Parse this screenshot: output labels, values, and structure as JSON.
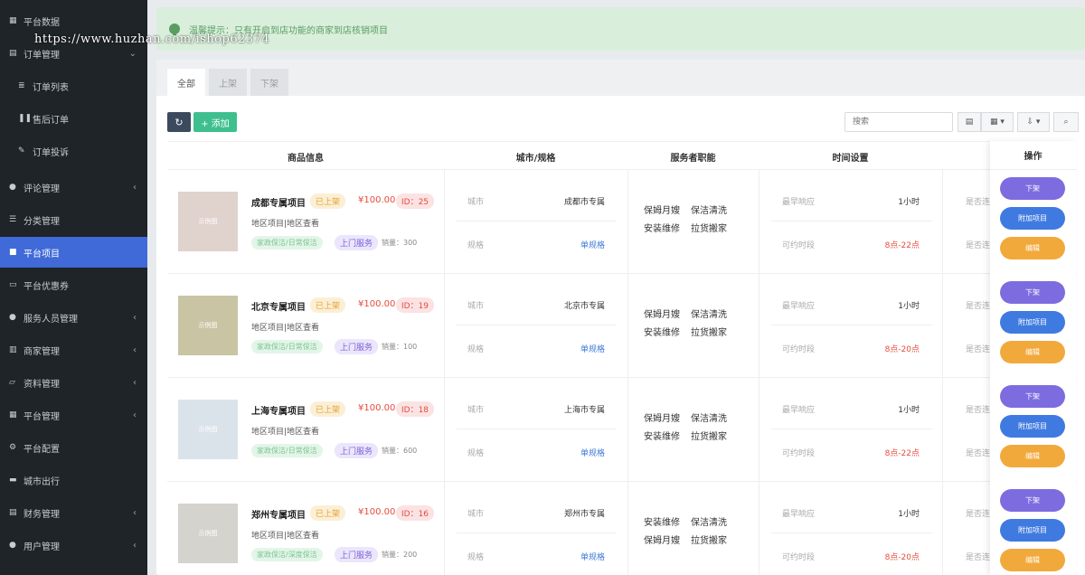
{
  "watermark": "https://www.huzhan.com/ishop62374",
  "sidebar": {
    "items": [
      {
        "label": "平台数据",
        "icon": "bar-chart-icon",
        "glyph": "▦",
        "sub": false,
        "arrow": false,
        "active": false
      },
      {
        "label": "订单管理",
        "icon": "list-icon",
        "glyph": "▤",
        "sub": false,
        "arrow": true,
        "arrow_glyph": "⌄",
        "active": false
      },
      {
        "label": "订单列表",
        "icon": "list-icon",
        "glyph": "≣",
        "sub": true,
        "arrow": false,
        "active": false
      },
      {
        "label": "售后订单",
        "icon": "pause-icon",
        "glyph": "❚❚",
        "sub": true,
        "arrow": false,
        "active": false
      },
      {
        "label": "订单投诉",
        "icon": "hammer-icon",
        "glyph": "✎",
        "sub": true,
        "arrow": false,
        "active": false
      },
      {
        "label": "评论管理",
        "icon": "comment-icon",
        "glyph": "●",
        "sub": false,
        "arrow": true,
        "arrow_glyph": "‹",
        "active": false
      },
      {
        "label": "分类管理",
        "icon": "sliders-icon",
        "glyph": "☰",
        "sub": false,
        "arrow": false,
        "active": false
      },
      {
        "label": "平台项目",
        "icon": "shopping-bag-icon",
        "glyph": "■",
        "sub": false,
        "arrow": false,
        "active": true
      },
      {
        "label": "平台优惠券",
        "icon": "ticket-icon",
        "glyph": "▭",
        "sub": false,
        "arrow": false,
        "active": false
      },
      {
        "label": "服务人员管理",
        "icon": "users-icon",
        "glyph": "●",
        "sub": false,
        "arrow": true,
        "arrow_glyph": "‹",
        "active": false
      },
      {
        "label": "商家管理",
        "icon": "bank-icon",
        "glyph": "▥",
        "sub": false,
        "arrow": true,
        "arrow_glyph": "‹",
        "active": false
      },
      {
        "label": "资料管理",
        "icon": "folder-icon",
        "glyph": "▱",
        "sub": false,
        "arrow": true,
        "arrow_glyph": "‹",
        "active": false
      },
      {
        "label": "平台管理",
        "icon": "grid-icon",
        "glyph": "▦",
        "sub": false,
        "arrow": true,
        "arrow_glyph": "‹",
        "active": false
      },
      {
        "label": "平台配置",
        "icon": "cogs-icon",
        "glyph": "⚙",
        "sub": false,
        "arrow": false,
        "active": false
      },
      {
        "label": "城市出行",
        "icon": "car-icon",
        "glyph": "▬",
        "sub": false,
        "arrow": false,
        "active": false
      },
      {
        "label": "财务管理",
        "icon": "wallet-icon",
        "glyph": "▤",
        "sub": false,
        "arrow": true,
        "arrow_glyph": "‹",
        "active": false
      },
      {
        "label": "用户管理",
        "icon": "user-circle-icon",
        "glyph": "●",
        "sub": false,
        "arrow": true,
        "arrow_glyph": "‹",
        "active": false
      }
    ]
  },
  "notice": {
    "text": "温馨提示：只有开启到店功能的商家到店核销项目"
  },
  "tabs": [
    "全部",
    "上架",
    "下架"
  ],
  "toolbar": {
    "refresh_glyph": "↻",
    "add_label": "+ 添加",
    "search_placeholder": "搜索",
    "table_btn": "▤",
    "columns_btn": "▦ ▾",
    "export_btn": "⇩ ▾",
    "search_btn": "⌕"
  },
  "columns": {
    "product": "商品信息",
    "city_spec": "城市/规格",
    "duties": "服务者职能",
    "time": "时间设置",
    "ops": "操作"
  },
  "labels": {
    "city": "城市",
    "spec": "规格",
    "earliest": "最早响应",
    "bookable": "可约时段",
    "truncated": "是否连",
    "on_shelf": "已上架",
    "service": "上门服务",
    "area": "地区项目|地区查看",
    "thumb": "示例图",
    "btn_down": "下架",
    "btn_addon": "附加项目",
    "btn_edit": "编辑"
  },
  "products": [
    {
      "name": "成都专属项目",
      "price": "¥100.00",
      "id": "ID：25",
      "category": "家政保洁/日常保洁",
      "sales": "销量：300",
      "city": "成都市专属",
      "spec": "单规格",
      "duties": [
        "保姆月嫂",
        "保洁清洗",
        "安装维修",
        "拉货搬家"
      ],
      "earliest": "1小时",
      "slot": "8点-22点",
      "thumb_color": "#e0d2cd"
    },
    {
      "name": "北京专属项目",
      "price": "¥100.00",
      "id": "ID：19",
      "category": "家政保洁/日常保洁",
      "sales": "销量：100",
      "city": "北京市专属",
      "spec": "单规格",
      "duties": [
        "保姆月嫂",
        "保洁清洗",
        "安装维修",
        "拉货搬家"
      ],
      "earliest": "1小时",
      "slot": "8点-20点",
      "thumb_color": "#c9c4a4"
    },
    {
      "name": "上海专属项目",
      "price": "¥100.00",
      "id": "ID：18",
      "category": "家政保洁/日常保洁",
      "sales": "销量：600",
      "city": "上海市专属",
      "spec": "单规格",
      "duties": [
        "保姆月嫂",
        "保洁清洗",
        "安装维修",
        "拉货搬家"
      ],
      "earliest": "1小时",
      "slot": "8点-22点",
      "thumb_color": "#dbe3ea"
    },
    {
      "name": "郑州专属项目",
      "price": "¥100.00",
      "id": "ID：16",
      "category": "家政保洁/深度保洁",
      "sales": "销量：200",
      "city": "郑州市专属",
      "spec": "单规格",
      "duties": [
        "安装维修",
        "保洁清洗",
        "保姆月嫂",
        "拉货搬家"
      ],
      "earliest": "1小时",
      "slot": "8点-20点",
      "thumb_color": "#d4d3ce"
    }
  ],
  "colors": {
    "accent": "#3f6ad8",
    "sidebar_bg": "#1f2429",
    "success": "#3fbf8e",
    "danger": "#e74c3c",
    "warning": "#f2a93b",
    "purple": "#7d6ce0"
  }
}
